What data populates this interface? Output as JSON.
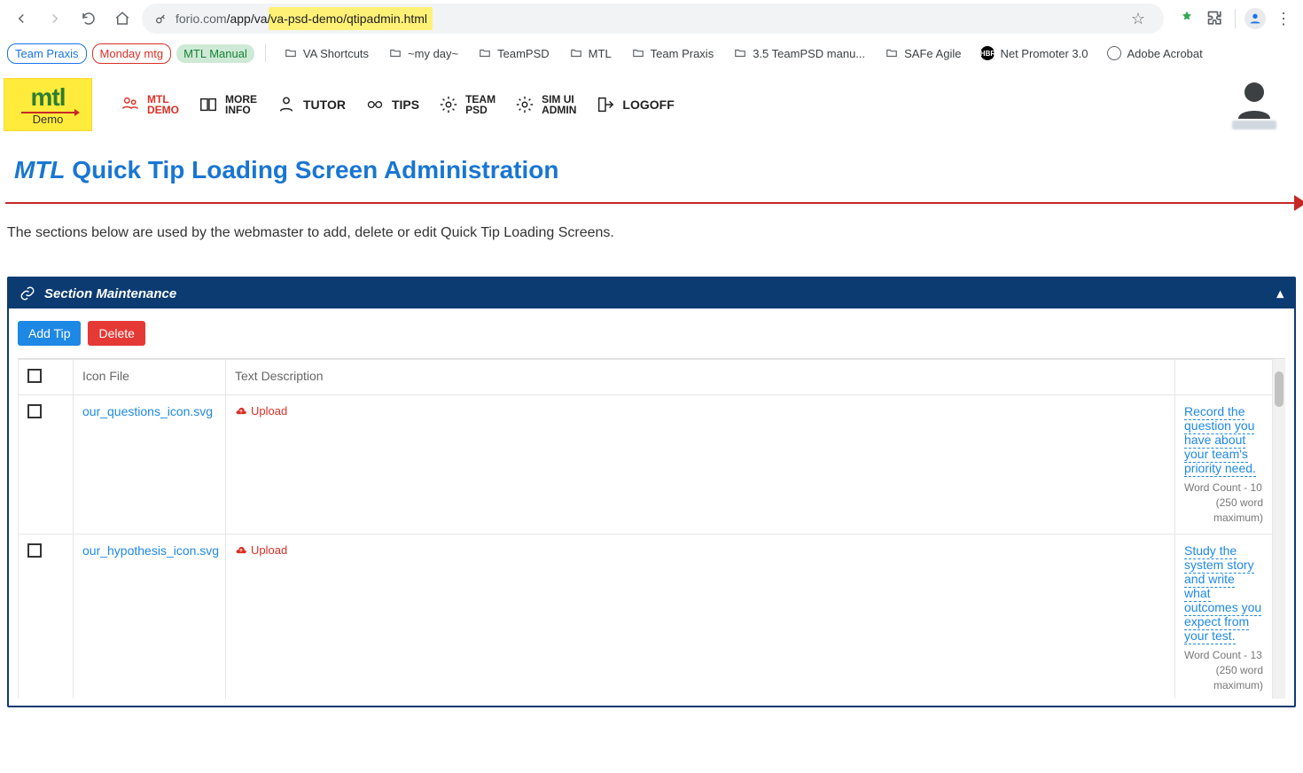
{
  "browser": {
    "url_pre": "forio.com",
    "url_post": "/app/va/va-psd-demo/qtipadmin.html",
    "url_highlight": "/va-psd-demo/qtipadmin.html"
  },
  "bookmarks": {
    "chips": [
      "Team Praxis",
      "Monday mtg",
      "MTL Manual"
    ],
    "items": [
      "VA Shortcuts",
      "~my day~",
      "TeamPSD",
      "MTL",
      "Team Praxis",
      "3.5 TeamPSD manu...",
      "SAFe Agile",
      "Net Promoter 3.0",
      "Adobe Acrobat"
    ]
  },
  "logo": {
    "top": "mtl",
    "sub": "Demo"
  },
  "nav": [
    {
      "id": "mtl-demo",
      "line1": "MTL",
      "line2": "DEMO",
      "active": true
    },
    {
      "id": "more-info",
      "line1": "MORE",
      "line2": "INFO"
    },
    {
      "id": "tutor",
      "line1": "TUTOR",
      "line2": ""
    },
    {
      "id": "tips",
      "line1": "TIPS",
      "line2": ""
    },
    {
      "id": "team-psd",
      "line1": "TEAM",
      "line2": "PSD"
    },
    {
      "id": "sim-ui",
      "line1": "SIM UI",
      "line2": "ADMIN"
    },
    {
      "id": "logoff",
      "line1": "LOGOFF",
      "line2": ""
    }
  ],
  "page": {
    "title_emph": "MTL",
    "title_rest": " Quick Tip Loading Screen Administration",
    "subtitle": "The sections below are used by the webmaster to add, delete or edit Quick Tip Loading Screens."
  },
  "panel": {
    "header": "Section Maintenance",
    "add_label": "Add Tip",
    "delete_label": "Delete",
    "columns": {
      "file": "Icon File",
      "desc": "Text Description"
    },
    "upload_label": "Upload",
    "rows": [
      {
        "file": "our_questions_icon.svg",
        "tip": "Record the question you have about your team's priority need.",
        "word_count": "Word Count -  10",
        "max": "(250 word maximum)"
      },
      {
        "file": "our_hypothesis_icon.svg",
        "tip": "Study the system story and write what outcomes you expect from your test.",
        "word_count": "Word Count -  13",
        "max": "(250 word maximum)"
      }
    ]
  }
}
